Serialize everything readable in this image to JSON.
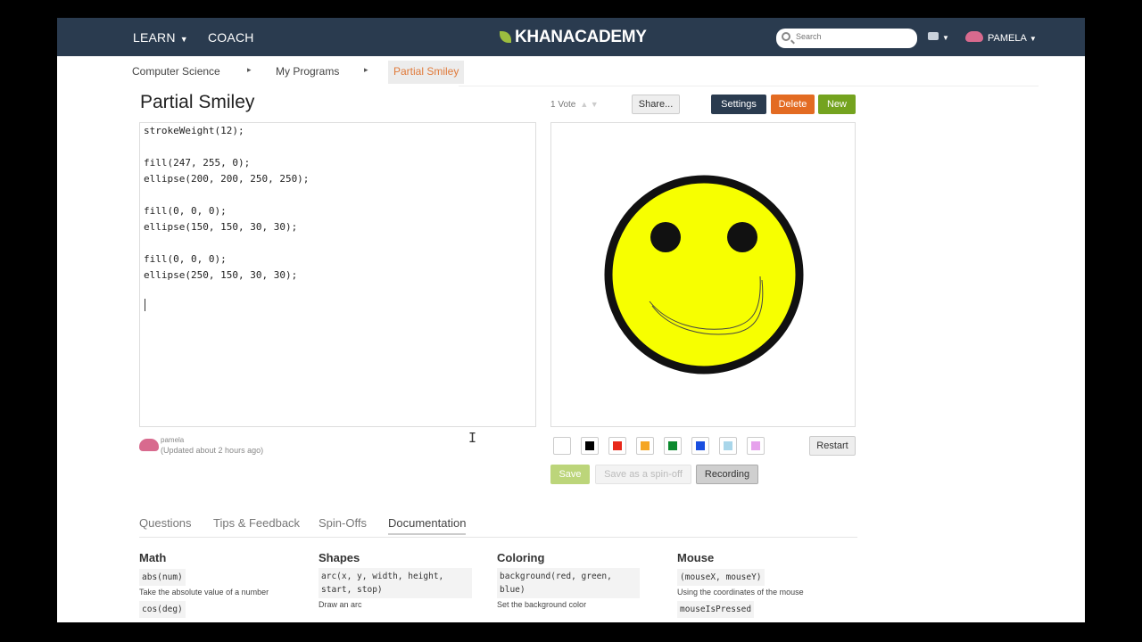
{
  "nav": {
    "learn": "LEARN",
    "coach": "COACH",
    "logo": "KHANACADEMY",
    "search_placeholder": "Search",
    "user": "PAMELA"
  },
  "breadcrumb": {
    "items": [
      "Computer Science",
      "My Programs"
    ],
    "separator": "▸",
    "current": "Partial Smiley"
  },
  "program": {
    "title": "Partial Smiley",
    "votes": "1 Vote",
    "share_label": "Share...",
    "settings_label": "Settings",
    "delete_label": "Delete",
    "new_label": "New"
  },
  "editor": {
    "lines": [
      "strokeWeight(12);",
      "",
      "fill(247, 255, 0);",
      "ellipse(200, 200, 250, 250);",
      "",
      "fill(0, 0, 0);",
      "ellipse(150, 150, 30, 30);",
      "",
      "fill(0, 0, 0);",
      "ellipse(250, 150, 30, 30);"
    ]
  },
  "author": {
    "name": "pamela",
    "updated": "(Updated about 2 hours ago)"
  },
  "drawing": {
    "swatches": [
      "#ffffff",
      "#000000",
      "#e8281a",
      "#f5a623",
      "#0c8a2e",
      "#1a4fe0",
      "#a9d6ea",
      "#e6a2ec"
    ],
    "restart_label": "Restart",
    "save_label": "Save",
    "spinoff_label": "Save as a spin-off",
    "recording_label": "Recording"
  },
  "tabs": [
    "Questions",
    "Tips & Feedback",
    "Spin-Offs",
    "Documentation"
  ],
  "docs": [
    {
      "heading": "Math",
      "code": "abs(num)",
      "desc": "Take the absolute value of a number",
      "code2": "cos(deg)"
    },
    {
      "heading": "Shapes",
      "code": "arc(x, y, width, height, start, stop)",
      "desc": "Draw an arc",
      "code2": ""
    },
    {
      "heading": "Coloring",
      "code": "background(red, green, blue)",
      "desc": "Set the background color",
      "code2": ""
    },
    {
      "heading": "Mouse",
      "code": "(mouseX, mouseY)",
      "desc": "Using the coordinates of the mouse",
      "code2": "mouseIsPressed"
    }
  ],
  "colors": {
    "nav_bg": "#2a3b4f",
    "face": "#f7ff00",
    "delete": "#e36b22",
    "new": "#74a31f"
  }
}
